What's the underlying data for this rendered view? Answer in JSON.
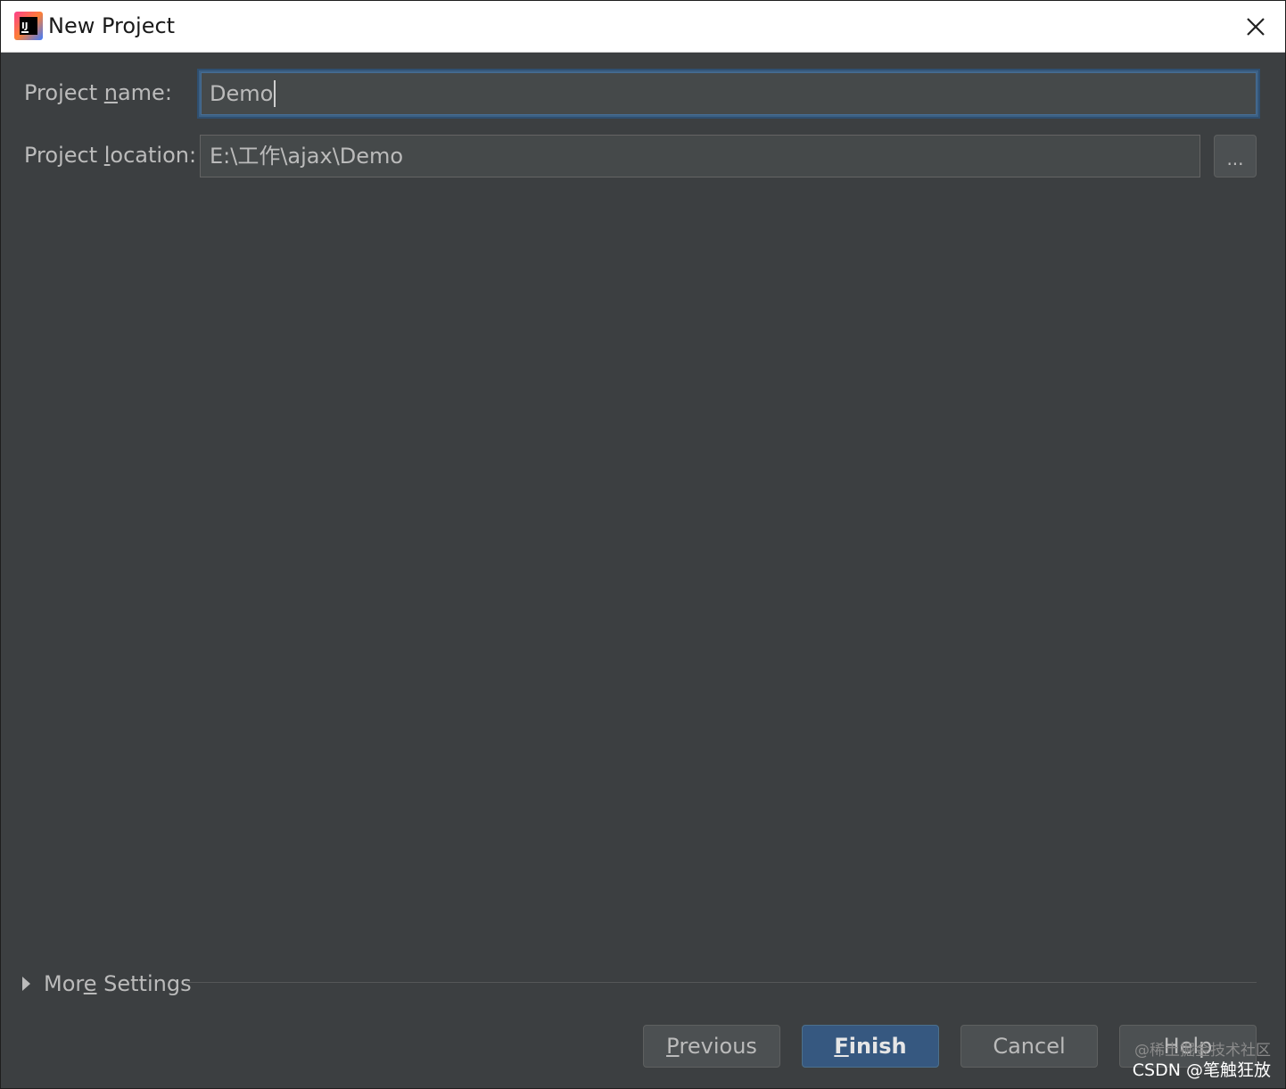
{
  "window": {
    "title": "New Project",
    "app_icon": "intellij-idea-icon",
    "close_icon": "close-icon"
  },
  "form": {
    "name_label_pre": "Project ",
    "name_label_u": "n",
    "name_label_post": "ame:",
    "name_value": "Demo",
    "location_label_pre": "Project ",
    "location_label_u": "l",
    "location_label_post": "ocation:",
    "location_value": "E:\\工作\\ajax\\Demo",
    "browse_label": "..."
  },
  "more_settings": {
    "label_pre": "Mor",
    "label_u": "e",
    "label_post": " Settings"
  },
  "buttons": {
    "previous_u": "P",
    "previous_rest": "revious",
    "finish_u": "F",
    "finish_rest": "inish",
    "cancel": "Cancel",
    "help": "Help"
  },
  "watermark": {
    "line1": "@稀土掘金技术社区",
    "line2": "CSDN @笔触狂放"
  },
  "colors": {
    "background": "#3c3f41",
    "field_bg": "#45494a",
    "focus_border": "#3d6185",
    "primary_button": "#365880",
    "text": "#bbbbbb"
  }
}
